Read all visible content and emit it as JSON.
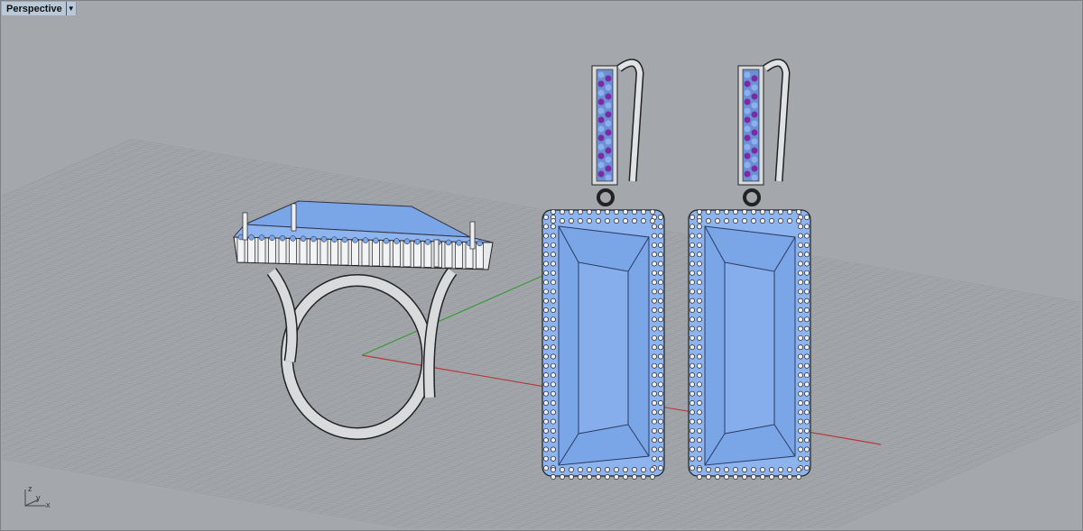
{
  "viewport": {
    "title": "Perspective",
    "menu_icon": "triangle-down-icon"
  },
  "axis_icon": {
    "x": "x",
    "y": "y",
    "z": "z"
  },
  "colors": {
    "background": "#a4a7ab",
    "grid": "#979a9f",
    "x_axis": "#b03a3a",
    "y_axis": "#3a9a3a",
    "gem": "#7aa6e8",
    "metal": "#d8dadc",
    "accent_gem": "#7a2aa8"
  }
}
